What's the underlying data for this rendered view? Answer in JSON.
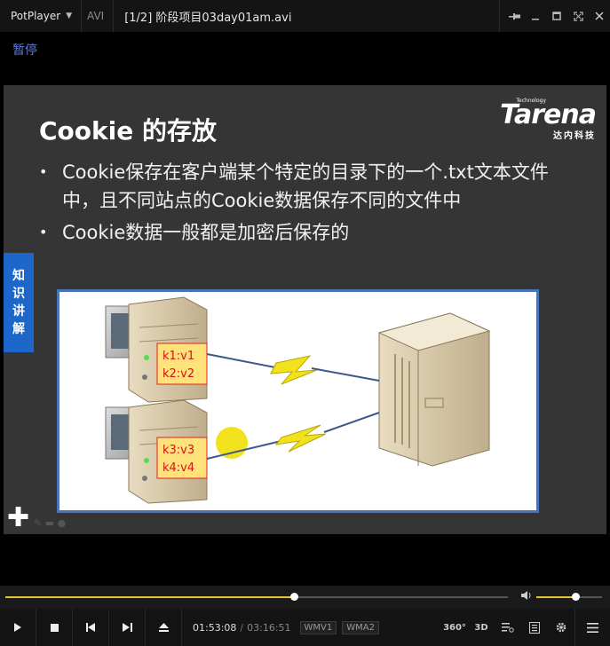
{
  "titlebar": {
    "app_name": "PotPlayer",
    "format": "AVI",
    "window_title": "[1/2] 阶段项目03day01am.avi",
    "icons": [
      "pin-icon",
      "minimize-icon",
      "maximize-icon",
      "fullscreen-icon",
      "close-icon"
    ]
  },
  "osd": {
    "status": "暂停"
  },
  "slide": {
    "title": "Cookie 的存放",
    "logo": {
      "tech": "Technology",
      "word": "Tarena",
      "cn": "达内科技"
    },
    "bullets": [
      "Cookie保存在客户端某个特定的目录下的一个.txt文本文件中，且不同站点的Cookie数据保存不同的文件中",
      "Cookie数据一般都是加密后保存的"
    ],
    "side_tab": [
      "知",
      "识",
      "讲",
      "解"
    ],
    "diagram": {
      "client1": {
        "cookies": [
          "k1:v1",
          "k2:v2"
        ]
      },
      "client2": {
        "cookies": [
          "k3:v3",
          "k4:v4"
        ]
      }
    }
  },
  "playback": {
    "progress": 0.574,
    "volume": 0.59,
    "current_time": "01:53:08",
    "total_time": "03:16:51",
    "video_codec": "WMV1",
    "audio_codec": "WMA2",
    "right_labels": {
      "vr": "360°",
      "stereo": "3D"
    }
  },
  "colors": {
    "accent": "#e3c534",
    "osd": "#5f7bd6",
    "side_tab": "#1c67c9",
    "diagram_border": "#4a74b8"
  }
}
